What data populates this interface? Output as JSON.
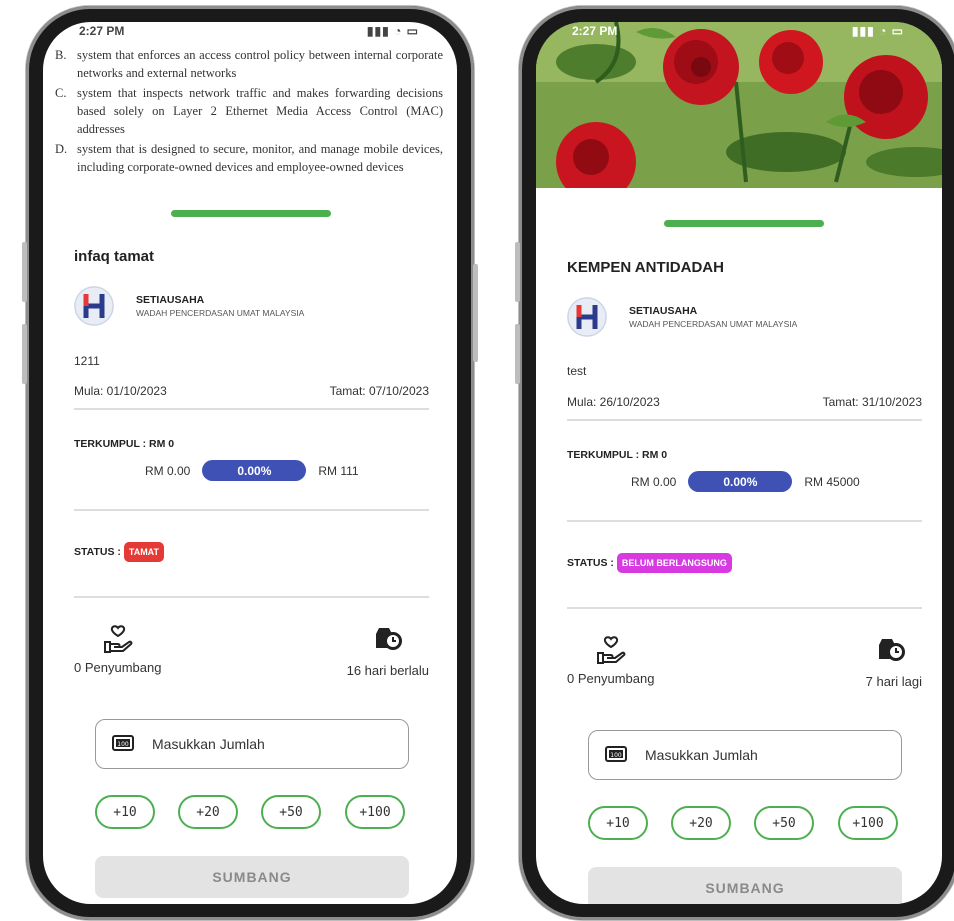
{
  "phone_left": {
    "status_time": "2:27 PM",
    "question_options": [
      {
        "letter": "B.",
        "text": "system that enforces an access control policy between internal corporate networks and external networks"
      },
      {
        "letter": "C.",
        "text": "system that inspects network traffic and makes forwarding decisions based solely on Layer 2 Ethernet Media Access Control (MAC) addresses"
      },
      {
        "letter": "D.",
        "text": "system that is designed to secure, monitor, and manage mobile devices, including corporate-owned devices and employee-owned devices"
      }
    ],
    "campaign_title": "infaq tamat",
    "org_name": "SETIAUSAHA",
    "org_subtitle": "WADAH PENCERDASAN UMAT MALAYSIA",
    "description": "1211",
    "start_date": "Mula: 01/10/2023",
    "end_date": "Tamat: 07/10/2023",
    "collected_label": "TERKUMPUL : RM 0",
    "progress_min": "RM 0.00",
    "progress_pct": "0.00%",
    "progress_target": "RM 111",
    "status_label": "STATUS :",
    "status_value": "TAMAT",
    "status_color": "#e53935",
    "donors": "0 Penyumbang",
    "time_info": "16 hari berlalu",
    "amount_placeholder": "Masukkan Jumlah",
    "quick_amounts": [
      "+10",
      "+20",
      "+50",
      "+100"
    ],
    "submit_label": "SUMBANG"
  },
  "phone_right": {
    "status_time": "2:27 PM",
    "campaign_title": "KEMPEN ANTIDADAH",
    "org_name": "SETIAUSAHA",
    "org_subtitle": "WADAH PENCERDASAN UMAT MALAYSIA",
    "description": "test",
    "start_date": "Mula: 26/10/2023",
    "end_date": "Tamat: 31/10/2023",
    "collected_label": "TERKUMPUL : RM 0",
    "progress_min": "RM 0.00",
    "progress_pct": "0.00%",
    "progress_target": "RM 45000",
    "status_label": "STATUS :",
    "status_value": "BELUM BERLANGSUNG",
    "status_color": "#d63ae0",
    "donors": "0 Penyumbang",
    "time_info": "7 hari lagi",
    "amount_placeholder": "Masukkan Jumlah",
    "quick_amounts": [
      "+10",
      "+20",
      "+50",
      "+100"
    ],
    "submit_label": "SUMBANG"
  },
  "colors": {
    "accent_green": "#4caf50",
    "progress_blue": "#3f51b5"
  }
}
